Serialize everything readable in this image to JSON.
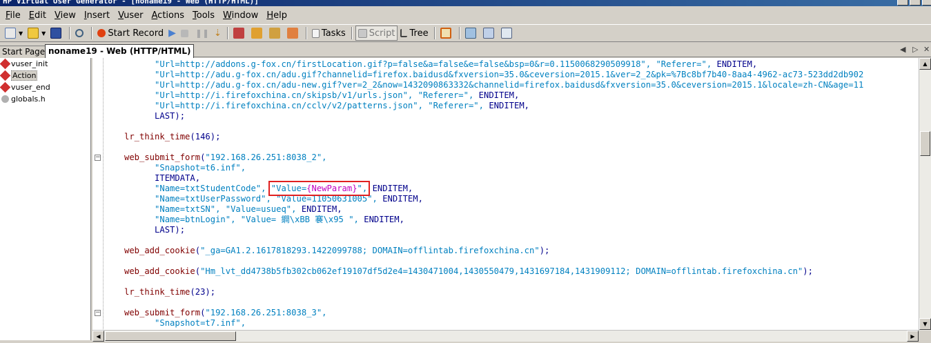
{
  "window": {
    "title": "HP Virtual User Generator - [noname19 - Web (HTTP/HTML)]"
  },
  "menu": [
    "File",
    "Edit",
    "View",
    "Insert",
    "Vuser",
    "Actions",
    "Tools",
    "Window",
    "Help"
  ],
  "toolbar": {
    "start_record": "Start Record",
    "tasks": "Tasks",
    "script": "Script",
    "tree": "Tree"
  },
  "tabs": {
    "start_page": "Start Page",
    "active": "noname19 - Web (HTTP/HTML)"
  },
  "tree": {
    "items": [
      "vuser_init",
      "Action",
      "vuser_end",
      "globals.h"
    ],
    "selected": "Action"
  },
  "code_lines": [
    {
      "indent": "      ",
      "parts": [
        {
          "t": "\"Url=http://addons.g-fox.cn/firstLocation.gif?p=false&a=false&e=false&bsp=0&r=0.1150068290509918\", \"Referer=\", ",
          "c": "str"
        },
        {
          "t": "ENDITEM,",
          "c": "kw"
        }
      ]
    },
    {
      "indent": "      ",
      "parts": [
        {
          "t": "\"Url=http://adu.g-fox.cn/adu.gif?channelid=firefox.baidusd&fxversion=35.0&ceversion=2015.1&ver=2_2&pk=%7Bc8bf7b40-8aa4-4962-ac73-523dd2db902",
          "c": "str"
        }
      ]
    },
    {
      "indent": "      ",
      "parts": [
        {
          "t": "\"Url=http://adu.g-fox.cn/adu-new.gif?ver=2_2&now=1432090863332&channelid=firefox.baidusd&fxversion=35.0&ceversion=2015.1&locale=zh-CN&age=11",
          "c": "str"
        }
      ]
    },
    {
      "indent": "      ",
      "parts": [
        {
          "t": "\"Url=http://i.firefoxchina.cn/skipsb/v1/urls.json\", \"Referer=\", ",
          "c": "str"
        },
        {
          "t": "ENDITEM,",
          "c": "kw"
        }
      ]
    },
    {
      "indent": "      ",
      "parts": [
        {
          "t": "\"Url=http://i.firefoxchina.cn/cclv/v2/patterns.json\", \"Referer=\", ",
          "c": "str"
        },
        {
          "t": "ENDITEM,",
          "c": "kw"
        }
      ]
    },
    {
      "indent": "      ",
      "parts": [
        {
          "t": "LAST);",
          "c": "kw"
        }
      ]
    },
    {
      "indent": "",
      "parts": []
    },
    {
      "indent": "",
      "parts": [
        {
          "t": "lr_think_time",
          "c": "fn"
        },
        {
          "t": "(146);",
          "c": "kw"
        }
      ]
    },
    {
      "indent": "",
      "parts": []
    },
    {
      "indent": "",
      "parts": [
        {
          "t": "web_submit_form",
          "c": "fn"
        },
        {
          "t": "(",
          "c": "kw"
        },
        {
          "t": "\"192.168.26.251:8038_2\",",
          "c": "str"
        }
      ]
    },
    {
      "indent": "      ",
      "parts": [
        {
          "t": "\"Snapshot=t6.inf\",",
          "c": "str"
        }
      ]
    },
    {
      "indent": "      ",
      "parts": [
        {
          "t": "ITEMDATA,",
          "c": "kw"
        }
      ]
    },
    {
      "indent": "      ",
      "parts": [
        {
          "t": "\"Name=txtStudentCode\", ",
          "c": "str"
        },
        {
          "t": "\"Value=",
          "c": "str",
          "hl": true
        },
        {
          "t": "{NewParam}",
          "c": "param",
          "hl": true
        },
        {
          "t": "\",",
          "c": "str",
          "hl": true
        },
        {
          "t": " ENDITEM,",
          "c": "kw"
        }
      ]
    },
    {
      "indent": "      ",
      "parts": [
        {
          "t": "\"Name=txtUserPassword\", \"Value=11050631005\", ",
          "c": "str"
        },
        {
          "t": "ENDITEM,",
          "c": "kw"
        }
      ]
    },
    {
      "indent": "      ",
      "parts": [
        {
          "t": "\"Name=txtSN\", \"Value=usueq\", ",
          "c": "str"
        },
        {
          "t": "ENDITEM,",
          "c": "kw"
        }
      ]
    },
    {
      "indent": "      ",
      "parts": [
        {
          "t": "\"Name=btnLogin\", \"Value= 鐧\\xBB 褰\\x95 \", ",
          "c": "str"
        },
        {
          "t": "ENDITEM,",
          "c": "kw"
        }
      ]
    },
    {
      "indent": "      ",
      "parts": [
        {
          "t": "LAST);",
          "c": "kw"
        }
      ]
    },
    {
      "indent": "",
      "parts": []
    },
    {
      "indent": "",
      "parts": [
        {
          "t": "web_add_cookie",
          "c": "fn"
        },
        {
          "t": "(",
          "c": "kw"
        },
        {
          "t": "\"_ga=GA1.2.1617818293.1422099788; DOMAIN=offlintab.firefoxchina.cn\"",
          "c": "str"
        },
        {
          "t": ");",
          "c": "kw"
        }
      ]
    },
    {
      "indent": "",
      "parts": []
    },
    {
      "indent": "",
      "parts": [
        {
          "t": "web_add_cookie",
          "c": "fn"
        },
        {
          "t": "(",
          "c": "kw"
        },
        {
          "t": "\"Hm_lvt_dd4738b5fb302cb062ef19107df5d2e4=1430471004,1430550479,1431697184,1431909112; DOMAIN=offlintab.firefoxchina.cn\"",
          "c": "str"
        },
        {
          "t": ");",
          "c": "kw"
        }
      ]
    },
    {
      "indent": "",
      "parts": []
    },
    {
      "indent": "",
      "parts": [
        {
          "t": "lr_think_time",
          "c": "fn"
        },
        {
          "t": "(23);",
          "c": "kw"
        }
      ]
    },
    {
      "indent": "",
      "parts": []
    },
    {
      "indent": "",
      "parts": [
        {
          "t": "web_submit_form",
          "c": "fn"
        },
        {
          "t": "(",
          "c": "kw"
        },
        {
          "t": "\"192.168.26.251:8038_3\",",
          "c": "str"
        }
      ]
    },
    {
      "indent": "      ",
      "parts": [
        {
          "t": "\"Snapshot=t7.inf\",",
          "c": "str"
        }
      ]
    }
  ],
  "colors": {
    "title_bar": "#0a246a",
    "function": "#800000",
    "string": "#0080c0",
    "keyword": "#00008b",
    "parameter": "#c000c0",
    "highlight_box": "#e02020"
  }
}
